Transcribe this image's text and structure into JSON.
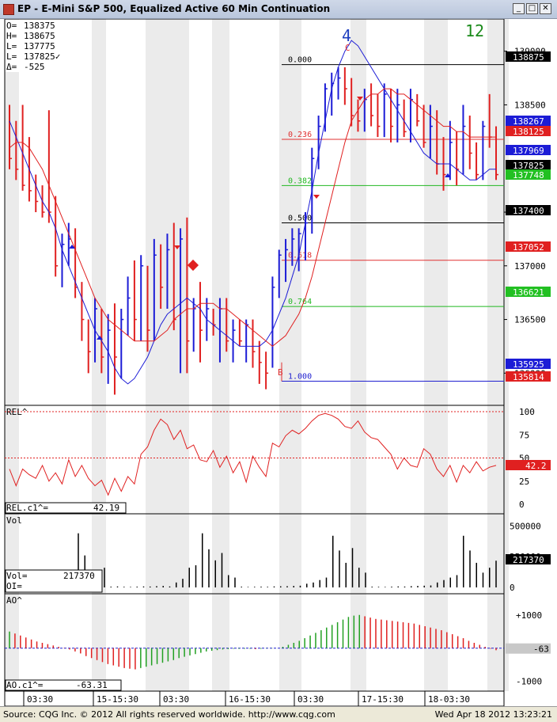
{
  "window": {
    "title": "EP - E-Mini S&P 500, Equalized Active 60 Min Continuation",
    "buttons": [
      "_",
      "□",
      "✕"
    ]
  },
  "ohlc_box": [
    {
      "label": "O=",
      "value": "138375"
    },
    {
      "label": "H=",
      "value": "138675"
    },
    {
      "label": "L=",
      "value": "137775"
    },
    {
      "label": "L=",
      "value": "137825✓"
    },
    {
      "label": "Δ=",
      "value": "-525"
    }
  ],
  "wave_labels": [
    {
      "text": "4",
      "color": "#1f3fbf"
    },
    {
      "text": "12",
      "color": "#1a8a1a"
    }
  ],
  "fib_levels": [
    {
      "label": "0.000",
      "color": "#000000"
    },
    {
      "label": "0.236",
      "color": "#e03030"
    },
    {
      "label": "0.382",
      "color": "#22b822"
    },
    {
      "label": "0.500",
      "color": "#000000"
    },
    {
      "label": "0.618",
      "color": "#e03030"
    },
    {
      "label": "0.764",
      "color": "#22b822"
    },
    {
      "label": "1.000",
      "color": "#2020d0"
    }
  ],
  "abc_labels": [
    {
      "text": "C",
      "color": "#e03030"
    },
    {
      "text": "B",
      "color": "#e03030"
    }
  ],
  "price_scale": {
    "ticks": [
      "139000",
      "138500",
      "137500",
      "137000",
      "136500",
      "136000"
    ],
    "tags": [
      {
        "text": "138875",
        "bg": "#000000",
        "fg": "#ffffff"
      },
      {
        "text": "138267",
        "bg": "#1c1cd6",
        "fg": "#ffffff"
      },
      {
        "text": "138125",
        "bg": "#e02020",
        "fg": "#ffffff"
      },
      {
        "text": "137969",
        "bg": "#1c1cd6",
        "fg": "#ffffff"
      },
      {
        "text": "137825",
        "bg": "#000000",
        "fg": "#ffffff"
      },
      {
        "text": "137748",
        "bg": "#22c022",
        "fg": "#ffffff"
      },
      {
        "text": "137400",
        "bg": "#000000",
        "fg": "#ffffff"
      },
      {
        "text": "137052",
        "bg": "#e02020",
        "fg": "#ffffff"
      },
      {
        "text": "136621",
        "bg": "#22c022",
        "fg": "#ffffff"
      },
      {
        "text": "135925",
        "bg": "#1c1cd6",
        "fg": "#ffffff"
      },
      {
        "text": "135814",
        "bg": "#e02020",
        "fg": "#ffffff"
      }
    ]
  },
  "rel_panel": {
    "title": "REL^",
    "readout_label": "REL.c1^=",
    "readout_value": "42.19",
    "ticks": [
      "100",
      "75",
      "50",
      "25",
      "0"
    ],
    "tag": "42.2"
  },
  "vol_panel": {
    "title": "Vol",
    "readout_vol_label": "Vol=",
    "readout_vol_value": "217370",
    "readout_oi_label": "OI=",
    "ticks": [
      "500000",
      "250000",
      "0"
    ],
    "tag": "217370"
  },
  "ao_panel": {
    "title": "AO^",
    "readout_label": "AO.c1^=",
    "readout_value": "-63.31",
    "ticks": [
      "+1000",
      "-1000"
    ],
    "tag": "-63"
  },
  "time_axis": [
    "03:30",
    "15-15:30",
    "03:30",
    "16-15:30",
    "03:30",
    "17-15:30",
    "18-03:30"
  ],
  "footer": {
    "source": "Source: CQG Inc. © 2012 All rights reserved worldwide. http://www.cqg.com",
    "timestamp": "Wed Apr 18 2012 13:23:21"
  },
  "colors": {
    "up_bar": "#1c1cd6",
    "down_bar": "#e02020",
    "ma_fast": "#1c1cd6",
    "ma_slow": "#e02020",
    "shade": "#ebebeb"
  },
  "chart_data": [
    {
      "type": "line",
      "title": "EP - E-Mini S&P 500, Equalized Active 60 Min Continuation",
      "ylim": [
        135700,
        139300
      ],
      "x": [
        "03:30",
        "15-15:30",
        "03:30",
        "16-15:30",
        "03:30",
        "17-15:30",
        "18-03:30"
      ],
      "bars": [
        [
          138300,
          138500,
          137900,
          138000
        ],
        [
          138200,
          138350,
          137800,
          137900
        ],
        [
          138050,
          138500,
          137700,
          137750
        ],
        [
          137900,
          138200,
          137600,
          137700
        ],
        [
          137700,
          137850,
          137500,
          137600
        ],
        [
          137600,
          137750,
          137450,
          137500
        ],
        [
          137600,
          138450,
          137400,
          137500
        ],
        [
          137500,
          137650,
          136900,
          137000
        ],
        [
          136950,
          137300,
          136800,
          137200
        ],
        [
          137200,
          137400,
          137000,
          137250
        ],
        [
          137200,
          137350,
          136700,
          136800
        ],
        [
          136700,
          136850,
          136300,
          136500
        ],
        [
          136400,
          136500,
          136000,
          136200
        ],
        [
          136200,
          136700,
          136100,
          136600
        ],
        [
          136500,
          136600,
          136000,
          136150
        ],
        [
          136100,
          136550,
          135900,
          136400
        ],
        [
          136300,
          136650,
          135800,
          136150
        ],
        [
          136100,
          136600,
          135950,
          136500
        ],
        [
          136500,
          136900,
          136350,
          136700
        ],
        [
          136700,
          137050,
          136300,
          136500
        ],
        [
          136500,
          137100,
          136300,
          137000
        ],
        [
          136800,
          137000,
          136200,
          136400
        ],
        [
          136400,
          137250,
          136300,
          137100
        ],
        [
          137100,
          137200,
          136600,
          136800
        ],
        [
          136800,
          137300,
          136600,
          137150
        ],
        [
          137150,
          137400,
          136400,
          136500
        ],
        [
          136500,
          137350,
          136000,
          137250
        ],
        [
          137250,
          137450,
          136000,
          136300
        ],
        [
          136300,
          136700,
          136200,
          136600
        ],
        [
          136600,
          136850,
          136100,
          136400
        ],
        [
          136450,
          136700,
          136300,
          136600
        ],
        [
          136500,
          136600,
          136350,
          136450
        ],
        [
          136500,
          136700,
          136100,
          136600
        ],
        [
          136550,
          136700,
          136200,
          136300
        ],
        [
          136350,
          136500,
          136100,
          136400
        ],
        [
          136350,
          136500,
          136250,
          136300
        ],
        [
          136400,
          136500,
          136100,
          136450
        ],
        [
          136400,
          136500,
          136050,
          136200
        ],
        [
          136200,
          136300,
          135900,
          136100
        ],
        [
          136100,
          136200,
          135850,
          136000
        ],
        [
          136150,
          136900,
          136050,
          136800
        ],
        [
          136800,
          137150,
          136700,
          137100
        ],
        [
          137100,
          137250,
          136850,
          137150
        ],
        [
          137150,
          137350,
          137000,
          137250
        ],
        [
          137200,
          137350,
          136950,
          137300
        ],
        [
          137300,
          137500,
          137050,
          137400
        ],
        [
          137400,
          138100,
          137300,
          138000
        ],
        [
          138000,
          138400,
          137900,
          138300
        ],
        [
          138300,
          138700,
          138250,
          138650
        ],
        [
          138650,
          138800,
          138400,
          138700
        ],
        [
          138700,
          138850,
          138550,
          138750
        ],
        [
          138750,
          138850,
          138500,
          138650
        ],
        [
          138650,
          138750,
          138300,
          138400
        ],
        [
          138400,
          138550,
          138250,
          138350
        ],
        [
          138350,
          138650,
          138250,
          138550
        ],
        [
          138550,
          138700,
          138300,
          138400
        ],
        [
          138400,
          138600,
          138200,
          138300
        ],
        [
          138300,
          138700,
          138200,
          138600
        ],
        [
          138600,
          138650,
          138150,
          138300
        ],
        [
          138300,
          138650,
          138150,
          138500
        ],
        [
          138500,
          138550,
          138200,
          138250
        ],
        [
          138250,
          138650,
          138150,
          138550
        ],
        [
          138550,
          138600,
          138300,
          138350
        ],
        [
          138350,
          138500,
          138100,
          138150
        ],
        [
          138150,
          138500,
          138000,
          138300
        ],
        [
          138300,
          138450,
          137850,
          137950
        ],
        [
          137950,
          138200,
          137700,
          137850
        ],
        [
          137850,
          138350,
          137800,
          138150
        ],
        [
          138150,
          138250,
          137750,
          137900
        ],
        [
          137900,
          138500,
          137850,
          138300
        ],
        [
          138300,
          138400,
          137900,
          138050
        ],
        [
          138050,
          138150,
          137800,
          137850
        ],
        [
          137850,
          138350,
          137800,
          138300
        ],
        [
          138300,
          138600,
          138100,
          138200
        ],
        [
          138200,
          138300,
          137800,
          137850
        ]
      ],
      "series": [
        {
          "name": "",
          "values": [
            138350,
            138200,
            138050,
            137900,
            137750,
            137600,
            137500,
            137350,
            137150,
            137000,
            136850,
            136700,
            136550,
            136400,
            136300,
            136200,
            136050,
            135950,
            135900,
            135950,
            136050,
            136150,
            136300,
            136450,
            136550,
            136600,
            136650,
            136700,
            136650,
            136600,
            136500,
            136450,
            136400,
            136350,
            136300,
            136250,
            136250,
            136250,
            136250,
            136300,
            136400,
            136550,
            136700,
            136900,
            137100,
            137400,
            137700,
            138050,
            138350,
            138650,
            138850,
            139000,
            139100,
            139050,
            138950,
            138850,
            138750,
            138650,
            138550,
            138450,
            138350,
            138250,
            138150,
            138050,
            138000,
            137950,
            137950,
            137950,
            137900,
            137850,
            137800,
            137800,
            137850,
            137900,
            137900
          ]
        },
        {
          "name": "",
          "values": [
            138100,
            138150,
            138150,
            138100,
            138000,
            137900,
            137750,
            137600,
            137450,
            137300,
            137150,
            137000,
            136850,
            136700,
            136600,
            136500,
            136450,
            136400,
            136350,
            136300,
            136300,
            136300,
            136300,
            136350,
            136400,
            136500,
            136550,
            136600,
            136600,
            136650,
            136650,
            136650,
            136600,
            136600,
            136550,
            136500,
            136450,
            136400,
            136350,
            136300,
            136250,
            136300,
            136350,
            136450,
            136550,
            136700,
            136900,
            137150,
            137400,
            137650,
            137900,
            138150,
            138350,
            138450,
            138550,
            138600,
            138600,
            138650,
            138650,
            138600,
            138600,
            138550,
            138500,
            138450,
            138400,
            138350,
            138300,
            138300,
            138250,
            138250,
            138200,
            138200,
            138200,
            138200,
            138200
          ]
        }
      ],
      "fibonacci": {
        "high": 138875,
        "low": 135925,
        "levels": [
          0.0,
          0.236,
          0.382,
          0.5,
          0.618,
          0.764,
          1.0
        ]
      }
    },
    {
      "type": "line",
      "title": "REL^",
      "ylim": [
        0,
        100
      ],
      "series": [
        {
          "name": "",
          "values": [
            38,
            20,
            38,
            32,
            28,
            42,
            25,
            34,
            22,
            48,
            30,
            42,
            28,
            20,
            26,
            10,
            28,
            14,
            30,
            22,
            54,
            62,
            80,
            92,
            86,
            70,
            80,
            60,
            64,
            48,
            46,
            58,
            40,
            52,
            34,
            46,
            24,
            52,
            40,
            30,
            66,
            62,
            74,
            80,
            76,
            82,
            90,
            96,
            98,
            96,
            92,
            84,
            82,
            90,
            78,
            72,
            70,
            62,
            54,
            38,
            50,
            42,
            40,
            60,
            54,
            38,
            30,
            42,
            24,
            42,
            34,
            46,
            36,
            40,
            42
          ]
        }
      ]
    },
    {
      "type": "bar",
      "title": "Vol",
      "ylim": [
        0,
        560000
      ],
      "values": [
        5000,
        8000,
        6000,
        10000,
        440000,
        260000,
        90000,
        120000,
        160000,
        6000,
        8000,
        5000,
        4000,
        6000,
        8000,
        7000,
        10000,
        12000,
        8000,
        40000,
        70000,
        160000,
        180000,
        440000,
        310000,
        220000,
        280000,
        100000,
        80000,
        6000,
        4000,
        5000,
        6000,
        5000,
        8000,
        9000,
        10000,
        12000,
        14000,
        30000,
        40000,
        60000,
        80000,
        420000,
        300000,
        200000,
        320000,
        160000,
        120000,
        6000,
        5000,
        4000,
        6000,
        8000,
        7000,
        10000,
        12000,
        14000,
        16000,
        40000,
        60000,
        80000,
        100000,
        420000,
        300000,
        200000,
        120000,
        160000,
        217370
      ]
    },
    {
      "type": "bar",
      "title": "AO^",
      "ylim": [
        -1200,
        1400
      ],
      "values": [
        500,
        440,
        380,
        320,
        260,
        200,
        160,
        120,
        80,
        40,
        10,
        -40,
        -100,
        -160,
        -240,
        -300,
        -360,
        -420,
        -480,
        -520,
        -560,
        -600,
        -620,
        -640,
        -600,
        -560,
        -520,
        -480,
        -440,
        -400,
        -360,
        -300,
        -260,
        -220,
        -180,
        -140,
        -100,
        -80,
        -60,
        -40,
        -30,
        -20,
        -20,
        -20,
        -20,
        -30,
        -20,
        -10,
        -10,
        0,
        40,
        100,
        160,
        220,
        300,
        380,
        460,
        540,
        620,
        700,
        780,
        860,
        940,
        980,
        1000,
        960,
        920,
        880,
        860,
        840,
        820,
        800,
        780,
        760,
        740,
        700,
        660,
        620,
        580,
        540,
        480,
        420,
        360,
        300,
        220,
        160,
        100,
        40,
        -20,
        -63
      ]
    }
  ]
}
